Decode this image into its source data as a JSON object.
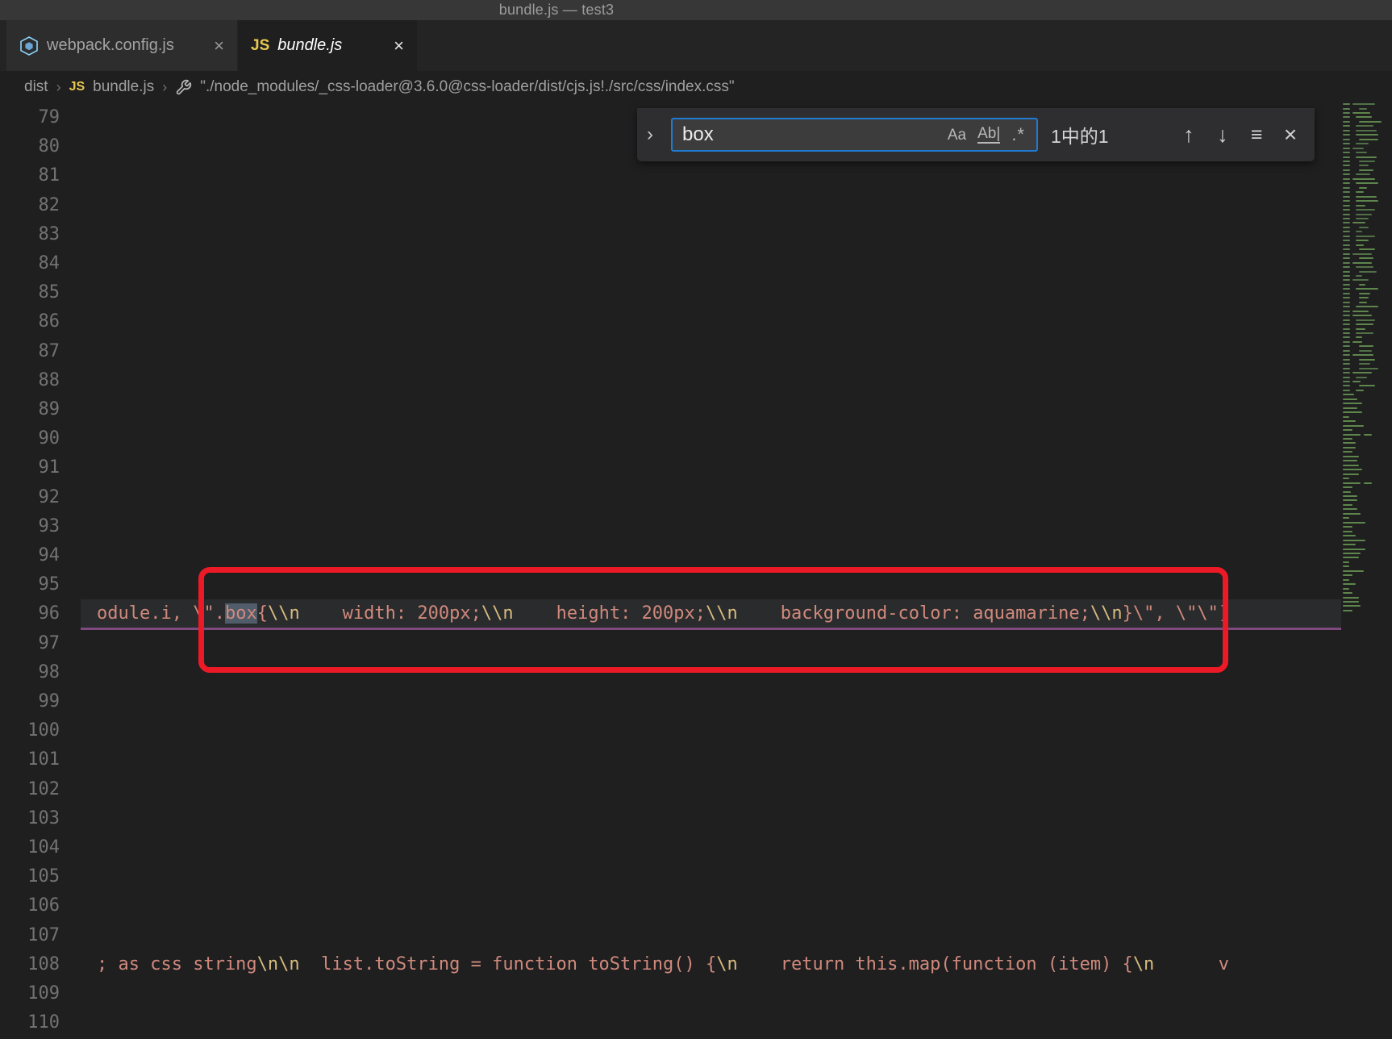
{
  "window": {
    "title": "bundle.js — test3"
  },
  "tabs": [
    {
      "label": "webpack.config.js",
      "icon": "webpack-icon",
      "close_glyph": "×",
      "active": false
    },
    {
      "label": "bundle.js",
      "icon": "js-icon",
      "js_badge": "JS",
      "close_glyph": "×",
      "active": true
    }
  ],
  "breadcrumbs": {
    "separator": "›",
    "items": [
      "dist",
      "bundle.js",
      "\"./node_modules/_css-loader@3.6.0@css-loader/dist/cjs.js!./src/css/index.css\""
    ],
    "js_badge": "JS"
  },
  "find": {
    "expand_glyph": "›",
    "query": "box",
    "match_case_glyph": "Aa",
    "whole_word_glyph": "Ab|",
    "regex_glyph": ".*",
    "result_count": "1中的1",
    "prev_glyph": "↑",
    "next_glyph": "↓",
    "selection_glyph": "≡",
    "close_glyph": "×"
  },
  "editor": {
    "first_line": 79,
    "last_line": 110,
    "current_line": 96,
    "line_height": 36.2,
    "lines": {
      "96": [
        {
          "c": "str",
          "t": "odule.i, \\\"."
        },
        {
          "c": "match",
          "t": "box"
        },
        {
          "c": "str",
          "t": "{"
        },
        {
          "c": "esc",
          "t": "\\\\n"
        },
        {
          "c": "str",
          "t": "    width: 200px;"
        },
        {
          "c": "esc",
          "t": "\\\\n"
        },
        {
          "c": "str",
          "t": "    height: 200px;"
        },
        {
          "c": "esc",
          "t": "\\\\n"
        },
        {
          "c": "str",
          "t": "    background-color: aquamarine;"
        },
        {
          "c": "esc",
          "t": "\\\\n"
        },
        {
          "c": "str",
          "t": "}\\\", \\\"\\\"]"
        }
      ],
      "108": [
        {
          "c": "str",
          "t": "; as css string"
        },
        {
          "c": "esc",
          "t": "\\n\\n"
        },
        {
          "c": "str",
          "t": "  list.toString = function toString() {"
        },
        {
          "c": "esc",
          "t": "\\n"
        },
        {
          "c": "str",
          "t": "    return this.map(function (item) {"
        },
        {
          "c": "esc",
          "t": "\\n"
        },
        {
          "c": "str",
          "t": "      v"
        }
      ]
    }
  },
  "minimap": {
    "rows": 116,
    "green_rows": 66,
    "row_step": 5.46,
    "gutter_color": "#5a7f4f",
    "palette": [
      "#6a9955",
      "#569cd6",
      "#9cdcfe",
      "#ce9178",
      "#c586c0",
      "#d7ba7d",
      "#4ec9b0",
      "#8a8a8a"
    ]
  },
  "colors": {
    "accent_blue": "#1f7ad1",
    "find_match_bg": "#515c6a",
    "string": "#d0897c",
    "escape": "#d7ba7d",
    "annotation_red": "#ec1a26",
    "current_line_underline": "#7e4a80"
  }
}
